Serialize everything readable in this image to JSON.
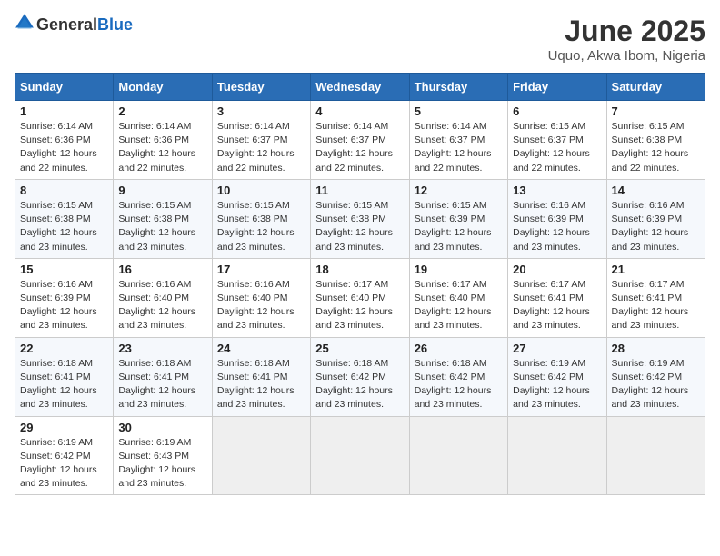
{
  "header": {
    "logo_general": "General",
    "logo_blue": "Blue",
    "month_year": "June 2025",
    "location": "Uquo, Akwa Ibom, Nigeria"
  },
  "weekdays": [
    "Sunday",
    "Monday",
    "Tuesday",
    "Wednesday",
    "Thursday",
    "Friday",
    "Saturday"
  ],
  "weeks": [
    [
      {
        "day": "1",
        "sunrise": "6:14 AM",
        "sunset": "6:36 PM",
        "daylight": "12 hours and 22 minutes."
      },
      {
        "day": "2",
        "sunrise": "6:14 AM",
        "sunset": "6:36 PM",
        "daylight": "12 hours and 22 minutes."
      },
      {
        "day": "3",
        "sunrise": "6:14 AM",
        "sunset": "6:37 PM",
        "daylight": "12 hours and 22 minutes."
      },
      {
        "day": "4",
        "sunrise": "6:14 AM",
        "sunset": "6:37 PM",
        "daylight": "12 hours and 22 minutes."
      },
      {
        "day": "5",
        "sunrise": "6:14 AM",
        "sunset": "6:37 PM",
        "daylight": "12 hours and 22 minutes."
      },
      {
        "day": "6",
        "sunrise": "6:15 AM",
        "sunset": "6:37 PM",
        "daylight": "12 hours and 22 minutes."
      },
      {
        "day": "7",
        "sunrise": "6:15 AM",
        "sunset": "6:38 PM",
        "daylight": "12 hours and 22 minutes."
      }
    ],
    [
      {
        "day": "8",
        "sunrise": "6:15 AM",
        "sunset": "6:38 PM",
        "daylight": "12 hours and 23 minutes."
      },
      {
        "day": "9",
        "sunrise": "6:15 AM",
        "sunset": "6:38 PM",
        "daylight": "12 hours and 23 minutes."
      },
      {
        "day": "10",
        "sunrise": "6:15 AM",
        "sunset": "6:38 PM",
        "daylight": "12 hours and 23 minutes."
      },
      {
        "day": "11",
        "sunrise": "6:15 AM",
        "sunset": "6:38 PM",
        "daylight": "12 hours and 23 minutes."
      },
      {
        "day": "12",
        "sunrise": "6:15 AM",
        "sunset": "6:39 PM",
        "daylight": "12 hours and 23 minutes."
      },
      {
        "day": "13",
        "sunrise": "6:16 AM",
        "sunset": "6:39 PM",
        "daylight": "12 hours and 23 minutes."
      },
      {
        "day": "14",
        "sunrise": "6:16 AM",
        "sunset": "6:39 PM",
        "daylight": "12 hours and 23 minutes."
      }
    ],
    [
      {
        "day": "15",
        "sunrise": "6:16 AM",
        "sunset": "6:39 PM",
        "daylight": "12 hours and 23 minutes."
      },
      {
        "day": "16",
        "sunrise": "6:16 AM",
        "sunset": "6:40 PM",
        "daylight": "12 hours and 23 minutes."
      },
      {
        "day": "17",
        "sunrise": "6:16 AM",
        "sunset": "6:40 PM",
        "daylight": "12 hours and 23 minutes."
      },
      {
        "day": "18",
        "sunrise": "6:17 AM",
        "sunset": "6:40 PM",
        "daylight": "12 hours and 23 minutes."
      },
      {
        "day": "19",
        "sunrise": "6:17 AM",
        "sunset": "6:40 PM",
        "daylight": "12 hours and 23 minutes."
      },
      {
        "day": "20",
        "sunrise": "6:17 AM",
        "sunset": "6:41 PM",
        "daylight": "12 hours and 23 minutes."
      },
      {
        "day": "21",
        "sunrise": "6:17 AM",
        "sunset": "6:41 PM",
        "daylight": "12 hours and 23 minutes."
      }
    ],
    [
      {
        "day": "22",
        "sunrise": "6:18 AM",
        "sunset": "6:41 PM",
        "daylight": "12 hours and 23 minutes."
      },
      {
        "day": "23",
        "sunrise": "6:18 AM",
        "sunset": "6:41 PM",
        "daylight": "12 hours and 23 minutes."
      },
      {
        "day": "24",
        "sunrise": "6:18 AM",
        "sunset": "6:41 PM",
        "daylight": "12 hours and 23 minutes."
      },
      {
        "day": "25",
        "sunrise": "6:18 AM",
        "sunset": "6:42 PM",
        "daylight": "12 hours and 23 minutes."
      },
      {
        "day": "26",
        "sunrise": "6:18 AM",
        "sunset": "6:42 PM",
        "daylight": "12 hours and 23 minutes."
      },
      {
        "day": "27",
        "sunrise": "6:19 AM",
        "sunset": "6:42 PM",
        "daylight": "12 hours and 23 minutes."
      },
      {
        "day": "28",
        "sunrise": "6:19 AM",
        "sunset": "6:42 PM",
        "daylight": "12 hours and 23 minutes."
      }
    ],
    [
      {
        "day": "29",
        "sunrise": "6:19 AM",
        "sunset": "6:42 PM",
        "daylight": "12 hours and 23 minutes."
      },
      {
        "day": "30",
        "sunrise": "6:19 AM",
        "sunset": "6:43 PM",
        "daylight": "12 hours and 23 minutes."
      },
      null,
      null,
      null,
      null,
      null
    ]
  ]
}
